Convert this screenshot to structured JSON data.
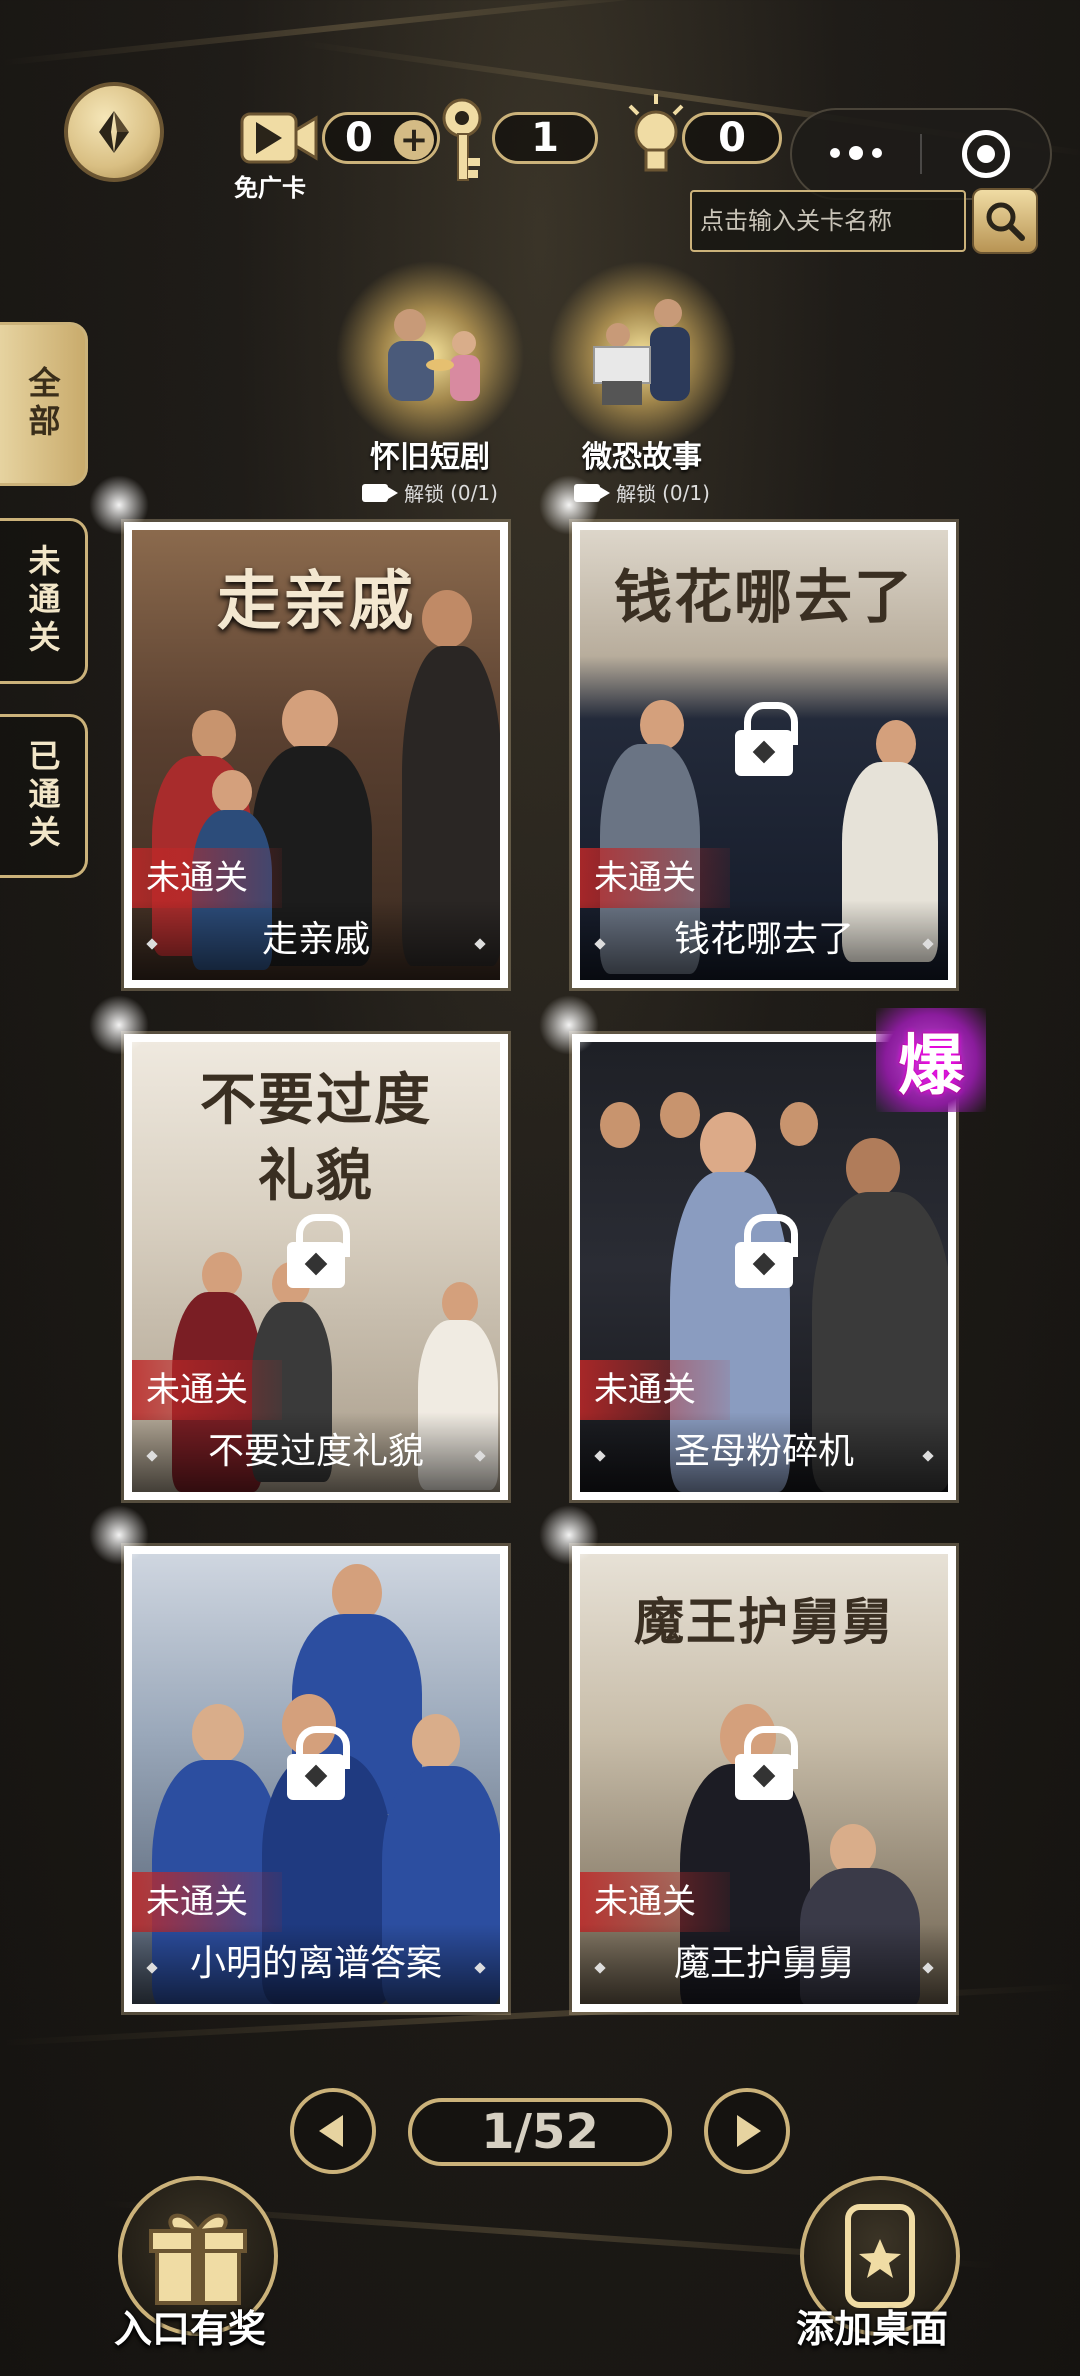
{
  "topbar": {
    "free_ad_count": "0",
    "free_ad_label": "免广卡",
    "keys": "1",
    "hints": "0"
  },
  "search": {
    "placeholder": "点击输入关卡名称"
  },
  "side_tabs": [
    {
      "label": "全部",
      "active": true
    },
    {
      "label": "未通关",
      "active": false
    },
    {
      "label": "已通关",
      "active": false
    }
  ],
  "categories": [
    {
      "title": "怀旧短剧",
      "unlock": "解锁",
      "progress": "(0/1)"
    },
    {
      "title": "微恐故事",
      "unlock": "解锁",
      "progress": "(0/1)"
    }
  ],
  "cards": [
    {
      "poster_text": "走亲戚",
      "name": "走亲戚",
      "status": "未通关",
      "locked": false
    },
    {
      "poster_text": "钱花哪去了",
      "name": "钱花哪去了",
      "status": "未通关",
      "locked": true
    },
    {
      "poster_text": "不要过度礼貌",
      "name": "不要过度礼貌",
      "status": "未通关",
      "locked": true
    },
    {
      "poster_text": "",
      "name": "圣母粉碎机",
      "status": "未通关",
      "locked": true,
      "badge": "爆"
    },
    {
      "poster_text": "",
      "name": "小明的离谱答案",
      "status": "未通关",
      "locked": true
    },
    {
      "poster_text": "魔王护舅舅",
      "name": "魔王护舅舅",
      "status": "未通关",
      "locked": true
    }
  ],
  "pagination": {
    "indicator": "1/52"
  },
  "bottom": {
    "reward_label": "入口有奖",
    "add_desktop_label": "添加桌面"
  }
}
